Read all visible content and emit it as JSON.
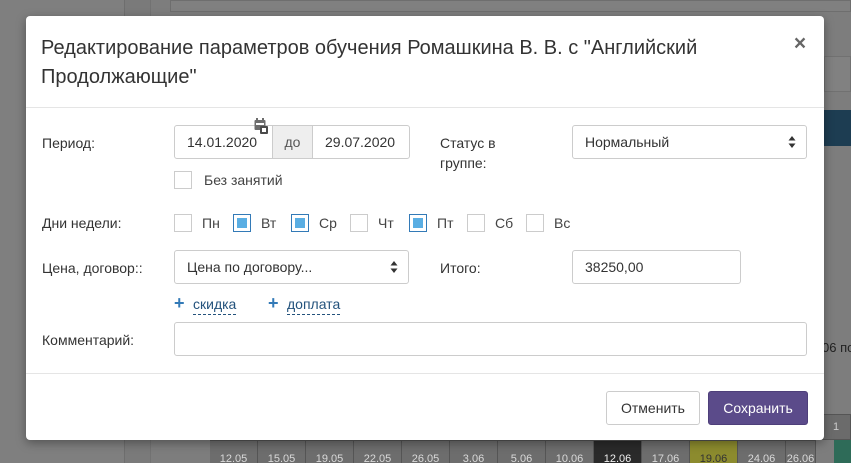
{
  "background": {
    "right_text": "06 по",
    "right_cell": "1",
    "dates": [
      "12.05",
      "15.05",
      "19.05",
      "22.05",
      "26.05",
      "3.06",
      "5.06",
      "10.06",
      "12.06",
      "17.06",
      "19.06",
      "24.06",
      "26.06"
    ]
  },
  "modal": {
    "title": "Редактирование параметров обучения Ромашкина В. В. с \"Английский Продолжающие\"",
    "close_symbol": "×"
  },
  "form": {
    "period_label": "Период:",
    "date_from": "14.01.2020",
    "to_label": "до",
    "date_to": "29.07.2020",
    "no_lessons_label": "Без занятий",
    "no_lessons_checked": false,
    "status_label": "Статус в группе:",
    "status_value": "Нормальный",
    "weekdays_label": "Дни недели:",
    "weekdays": [
      {
        "label": "Пн",
        "checked": false
      },
      {
        "label": "Вт",
        "checked": true
      },
      {
        "label": "Ср",
        "checked": true
      },
      {
        "label": "Чт",
        "checked": false
      },
      {
        "label": "Пт",
        "checked": true
      },
      {
        "label": "Сб",
        "checked": false
      },
      {
        "label": "Вс",
        "checked": false
      }
    ],
    "price_label": "Цена, договор::",
    "price_value": "Цена по договору...",
    "total_label": "Итого:",
    "total_value": "38250,00",
    "discount_link": "скидка",
    "surcharge_link": "доплата",
    "comment_label": "Комментарий:",
    "comment_value": ""
  },
  "footer": {
    "cancel_label": "Отменить",
    "save_label": "Сохранить"
  },
  "icons": {
    "calendar": "calendar-icon",
    "close": "close-icon",
    "plus": "plus-icon",
    "select_arrows": "select-arrows-icon"
  },
  "colors": {
    "primary": "#5b4b8a",
    "link": "#23527c",
    "checkbox_fill": "#5aaee3"
  }
}
